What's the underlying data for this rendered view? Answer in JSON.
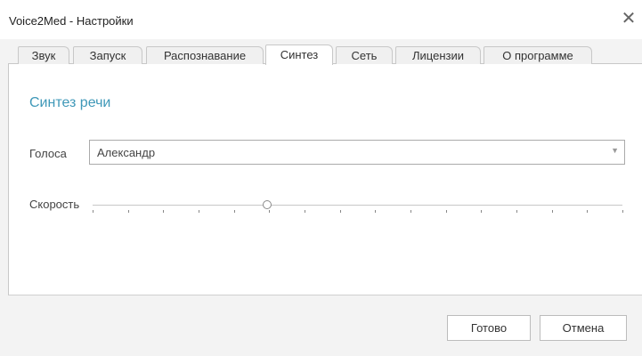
{
  "window": {
    "title": "Voice2Med - Настройки"
  },
  "tabs": [
    {
      "label": "Звук",
      "active": false
    },
    {
      "label": "Запуск",
      "active": false
    },
    {
      "label": "Распознавание",
      "active": false
    },
    {
      "label": "Синтез",
      "active": true
    },
    {
      "label": "Сеть",
      "active": false
    },
    {
      "label": "Лицензии",
      "active": false
    },
    {
      "label": "О программе",
      "active": false
    }
  ],
  "section": {
    "title": "Синтез речи"
  },
  "voices": {
    "label": "Голоса",
    "selected": "Александр"
  },
  "speed": {
    "label": "Скорость",
    "tick_count": 16,
    "value_fraction": 0.33
  },
  "buttons": {
    "done": "Готово",
    "cancel": "Отмена"
  },
  "icons": {
    "close": "close-icon",
    "dropdown": "chevron-down-icon"
  },
  "colors": {
    "accent": "#3f98b8",
    "border": "#c8c8c8",
    "background": "#f3f3f3"
  }
}
